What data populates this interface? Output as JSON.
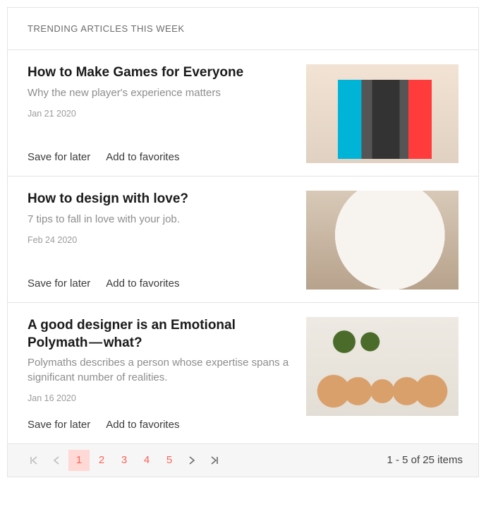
{
  "header": {
    "title": "Trending Articles This Week"
  },
  "articles": [
    {
      "title": "How to Make Games for Everyone",
      "excerpt": "Why the new player's experience matters",
      "date": "Jan 21 2020",
      "save_label": "Save for later",
      "fav_label": "Add to favorites"
    },
    {
      "title": "How to design with love?",
      "excerpt": "7 tips to fall in love with your job.",
      "date": "Feb 24 2020",
      "save_label": "Save for later",
      "fav_label": "Add to favorites"
    },
    {
      "title": "A good designer is an Emotional Polymath — what?",
      "excerpt": "Polymaths describes a person whose expertise spans a significant number of realities.",
      "date": "Jan 16 2020",
      "save_label": "Save for later",
      "fav_label": "Add to favorites"
    }
  ],
  "pager": {
    "pages": [
      "1",
      "2",
      "3",
      "4",
      "5"
    ],
    "current_index": 0,
    "info": "1 - 5 of 25 items"
  }
}
